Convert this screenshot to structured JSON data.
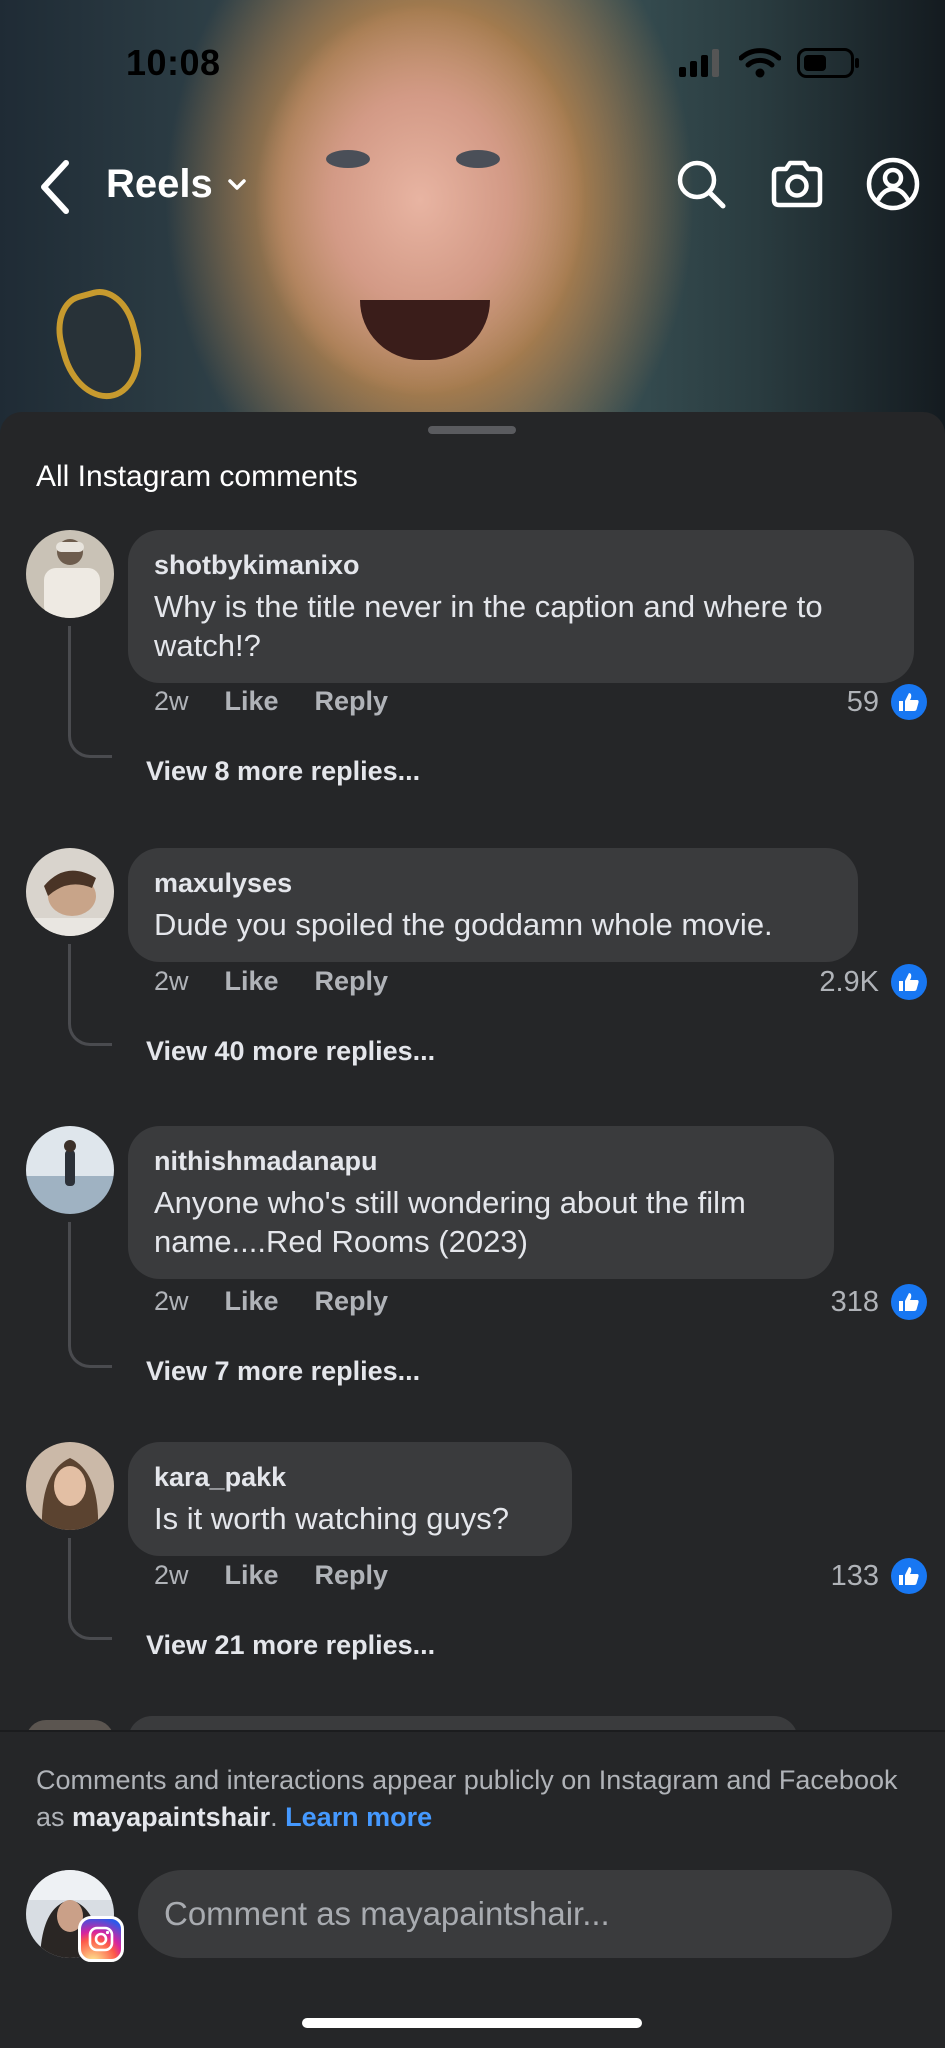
{
  "status_bar": {
    "time": "10:08"
  },
  "top_bar": {
    "title": "Reels"
  },
  "sheet": {
    "title": "All Instagram comments"
  },
  "comments": [
    {
      "username": "shotbykimanixo",
      "text": "Why is the title never in the caption and where to watch!?",
      "age": "2w",
      "like_label": "Like",
      "reply_label": "Reply",
      "likes": "59",
      "view_replies": "View 8 more replies..."
    },
    {
      "username": "maxulyses",
      "text": "Dude you spoiled the goddamn whole movie.",
      "age": "2w",
      "like_label": "Like",
      "reply_label": "Reply",
      "likes": "2.9K",
      "view_replies": "View 40 more replies..."
    },
    {
      "username": "nithishmadanapu",
      "text": "Anyone who's still wondering about the film name....Red Rooms (2023)",
      "age": "2w",
      "like_label": "Like",
      "reply_label": "Reply",
      "likes": "318",
      "view_replies": "View 7 more replies..."
    },
    {
      "username": "kara_pakk",
      "text": "Is it worth watching guys?",
      "age": "2w",
      "like_label": "Like",
      "reply_label": "Reply",
      "likes": "133",
      "view_replies": "View 21 more replies..."
    }
  ],
  "footer": {
    "notice_prefix": "Comments and interactions appear publicly on Instagram and Facebook as ",
    "notice_user": "mayapaintshair",
    "notice_suffix": ". ",
    "learn_more": "Learn more",
    "input_placeholder": "Comment as mayapaintshair..."
  },
  "colors": {
    "like_blue": "#1877f2",
    "link_blue": "#4599ff",
    "sheet_bg": "#252628",
    "bubble_bg": "#3a3b3d"
  }
}
